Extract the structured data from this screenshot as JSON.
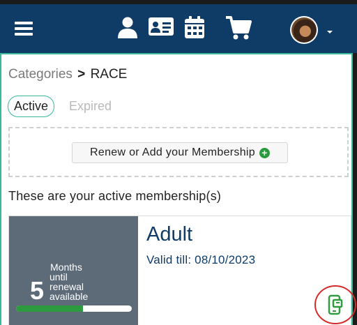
{
  "header": {
    "menu_icon": "hamburger-menu-icon",
    "nav_icons": [
      "user-icon",
      "id-card-icon",
      "calendar-icon",
      "shopping-cart-icon"
    ],
    "colors": {
      "bar": "#0f3b67",
      "accent": "#39b89a"
    }
  },
  "breadcrumb": {
    "parent": "Categories",
    "separator": ">",
    "current": "RACE"
  },
  "tabs": {
    "active": "Active",
    "inactive": "Expired"
  },
  "renew": {
    "label": "Renew or Add your Membership",
    "icon": "plus-circle-icon"
  },
  "subtitle": "These are your active membership(s)",
  "membership": {
    "title": "Adult",
    "valid_till": "Valid till: 08/10/2023",
    "months_count": "5",
    "months_line1": "Months",
    "months_line2": "until",
    "months_line3": "renewal",
    "months_line4": "available",
    "renewal_progress": 0.58,
    "wallet_icon": "mobile-wallet-icon"
  }
}
